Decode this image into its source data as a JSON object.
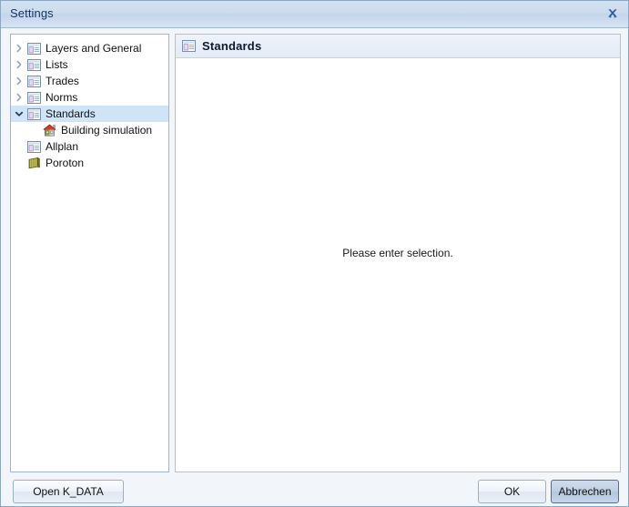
{
  "window": {
    "title": "Settings",
    "close_icon": "close-icon"
  },
  "tree": {
    "items": [
      {
        "label": "Layers and General",
        "icon": "document-list-icon",
        "twisty": "chevron-right-icon",
        "expanded": false,
        "selected": false,
        "child": false
      },
      {
        "label": "Lists",
        "icon": "document-list-icon",
        "twisty": "chevron-right-icon",
        "expanded": false,
        "selected": false,
        "child": false
      },
      {
        "label": "Trades",
        "icon": "document-list-icon",
        "twisty": "chevron-right-icon",
        "expanded": false,
        "selected": false,
        "child": false
      },
      {
        "label": "Norms",
        "icon": "document-list-icon",
        "twisty": "chevron-right-icon",
        "expanded": false,
        "selected": false,
        "child": false
      },
      {
        "label": "Standards",
        "icon": "document-list-icon",
        "twisty": "chevron-down-icon",
        "expanded": true,
        "selected": true,
        "child": false
      },
      {
        "label": "Building simulation",
        "icon": "house-icon",
        "twisty": "none",
        "expanded": false,
        "selected": false,
        "child": true
      },
      {
        "label": "Allplan",
        "icon": "document-list-icon",
        "twisty": "none",
        "expanded": false,
        "selected": false,
        "child": false
      },
      {
        "label": "Poroton",
        "icon": "brick-icon",
        "twisty": "none",
        "expanded": false,
        "selected": false,
        "child": false
      }
    ]
  },
  "content": {
    "header_title": "Standards",
    "header_icon": "document-list-icon",
    "message": "Please enter selection."
  },
  "footer": {
    "open_kdata_label": "Open K_DATA",
    "ok_label": "OK",
    "cancel_label": "Abbrechen"
  },
  "colors": {
    "titlebar_top": "#d3e1f0",
    "titlebar_bottom": "#d6e4f3",
    "window_border": "#8ba7c4",
    "selection": "#cfe4f7",
    "panel_background": "#f2f6fb",
    "close_glyph": "#2a5a9c",
    "house_roof": "#d23c2a",
    "brick": "#8a8a28"
  }
}
